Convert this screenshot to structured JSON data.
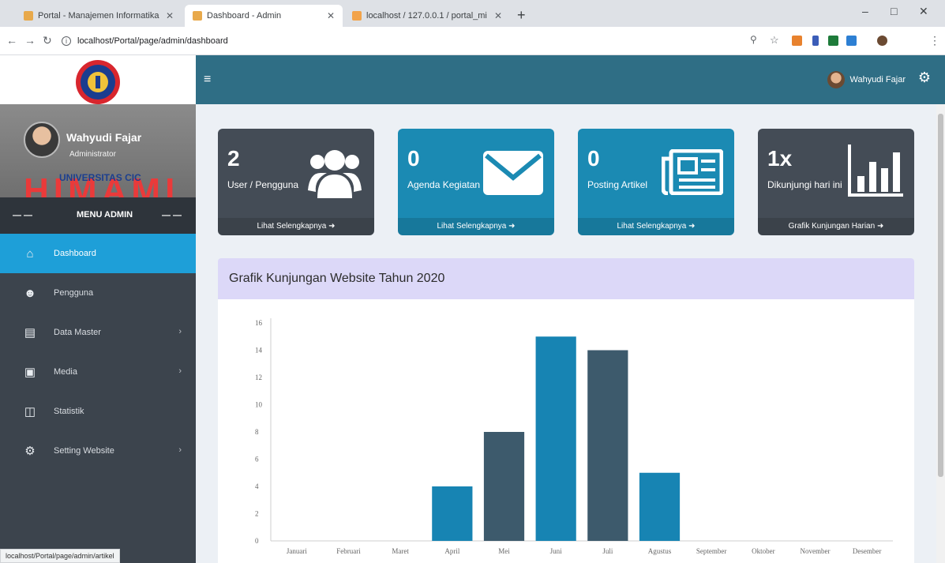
{
  "browser": {
    "tabs": [
      {
        "title": "Portal - Manajemen Informatika",
        "active": false
      },
      {
        "title": "Dashboard - Admin",
        "active": true
      },
      {
        "title": "localhost / 127.0.0.1 / portal_mi",
        "active": false
      }
    ],
    "new_tab": "+",
    "url": "localhost/Portal/page/admin/dashboard",
    "status_url": "localhost/Portal/page/admin/artikel"
  },
  "header": {
    "menu_toggle": "≡",
    "user_name": "Wahyudi Fajar"
  },
  "sidebar": {
    "profile": {
      "name": "Wahyudi Fajar",
      "role": "Administrator",
      "bg_text": "HIMAMI",
      "bg_caption": "UNIVERSITAS CIC"
    },
    "menu_title": "MENU ADMIN",
    "items": [
      {
        "label": "Dashboard",
        "icon": "home-icon",
        "active": true,
        "has_children": false
      },
      {
        "label": "Pengguna",
        "icon": "user-add-icon",
        "active": false,
        "has_children": false
      },
      {
        "label": "Data Master",
        "icon": "newspaper-icon",
        "active": false,
        "has_children": true
      },
      {
        "label": "Media",
        "icon": "image-icon",
        "active": false,
        "has_children": true
      },
      {
        "label": "Statistik",
        "icon": "bar-chart-icon",
        "active": false,
        "has_children": false
      },
      {
        "label": "Setting Website",
        "icon": "cogs-icon",
        "active": false,
        "has_children": true
      }
    ]
  },
  "stats": [
    {
      "value": "2",
      "label": "User / Pengguna",
      "link": "Lihat Selengkapnya",
      "icon": "users-icon",
      "color": "#444c56"
    },
    {
      "value": "0",
      "label": "Agenda Kegiatan",
      "link": "Lihat Selengkapnya",
      "icon": "envelope-icon",
      "color": "#1b8ab3"
    },
    {
      "value": "0",
      "label": "Posting Artikel",
      "link": "Lihat Selengkapnya",
      "icon": "newspaper-icon",
      "color": "#1b8ab3"
    },
    {
      "value": "1x",
      "label": "Dikunjungi hari ini",
      "link": "Grafik Kunjungan Harian",
      "icon": "bar-chart-icon",
      "color": "#444c56"
    }
  ],
  "chart_data": {
    "type": "bar",
    "title": "Grafik Kunjungan Website Tahun 2020",
    "categories": [
      "Januari",
      "Februari",
      "Maret",
      "April",
      "Mei",
      "Juni",
      "Juli",
      "Agustus",
      "September",
      "Oktober",
      "November",
      "Desember"
    ],
    "values": [
      0,
      0,
      0,
      4,
      8,
      15,
      14,
      5,
      0,
      0,
      0,
      0
    ],
    "bar_colors": [
      "#3d5a6c",
      "#1784b3"
    ],
    "ylim": [
      0,
      16
    ],
    "yticks": [
      0,
      2,
      4,
      6,
      8,
      10,
      12,
      14,
      16
    ],
    "grid": false
  }
}
